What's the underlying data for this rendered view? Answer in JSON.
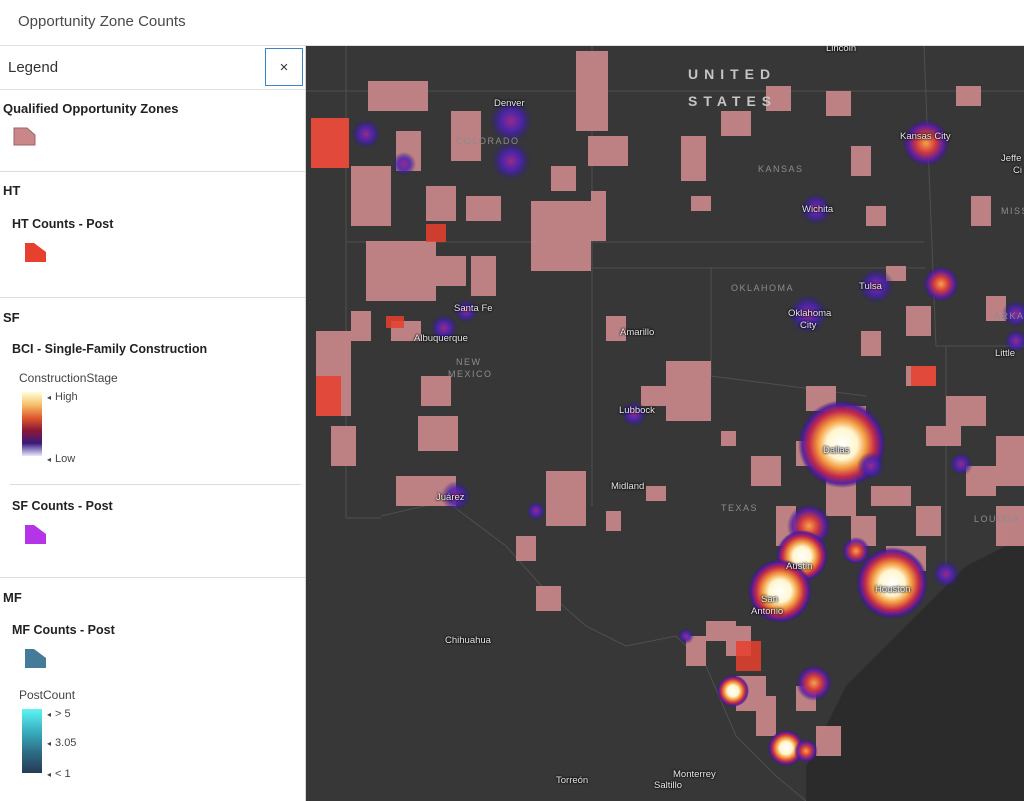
{
  "header": {
    "title": "Opportunity Zone Counts"
  },
  "legend": {
    "title": "Legend",
    "close_label": "×",
    "qoz": {
      "title": "Qualified Opportunity Zones"
    },
    "ht": {
      "title": "HT",
      "layer": "HT Counts - Post"
    },
    "sf": {
      "title": "SF",
      "layer": "BCI - Single-Family Construction",
      "field": "ConstructionStage",
      "high": "High",
      "low": "Low",
      "layer2": "SF Counts - Post"
    },
    "mf": {
      "title": "MF",
      "layer": "MF Counts - Post",
      "field": "PostCount",
      "max": "> 5",
      "mid": "3.05",
      "min": "< 1"
    }
  },
  "map": {
    "country": {
      "line1": "UNITED",
      "line2": "STATES"
    },
    "cities": {
      "lincoln": "Lincoln",
      "denver": "Denver",
      "kansas_city": "Kansas City",
      "jefferson": "Jeffe",
      "jefferson2": "Ci",
      "wichita": "Wichita",
      "tulsa": "Tulsa",
      "oklahoma_city": "Oklahoma",
      "oklahoma_city2": "City",
      "santa_fe": "Santa Fe",
      "albuquerque": "Albuquerque",
      "amarillo": "Amarillo",
      "lubbock": "Lubbock",
      "dallas": "Dallas",
      "midland": "Midland",
      "juarez": "Juárez",
      "austin": "Austin",
      "houston": "Houston",
      "san_antonio": "San",
      "san_antonio2": "Antonio",
      "chihuahua": "Chihuahua",
      "torreon": "Torreón",
      "monterrey": "Monterrey",
      "saltillo": "Saltillo",
      "little_rock": "Little"
    },
    "states": {
      "colorado": "COLORADO",
      "kansas": "KANSAS",
      "oklahoma": "OKLAHOMA",
      "new_mexico": "NEW",
      "new_mexico2": "MEXICO",
      "texas": "TEXAS",
      "louisiana": "LOUISIA",
      "missouri": "MISS",
      "arkansas": "ARKA"
    }
  },
  "colors": {
    "zone_fill": "#c9878a",
    "ht_fill": "#e8402e",
    "sf_fill": "#b534e8",
    "mf_fill": "#457a99",
    "map_bg": "#373737",
    "gulf": "#2a2a2a"
  }
}
